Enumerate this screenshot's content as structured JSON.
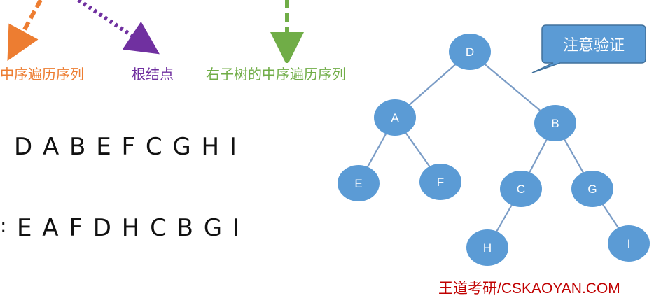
{
  "labels": {
    "left_inorder": "中序遍历序列",
    "root": "根结点",
    "right_inorder": "右子树的中序遍历序列"
  },
  "sequences": {
    "preorder": "D A B E F C G H I",
    "inorder_prefix": ":",
    "inorder": "E A F D H C B G I"
  },
  "callout": {
    "text": "注意验证"
  },
  "tree": {
    "nodes": [
      {
        "id": "D",
        "label": "D"
      },
      {
        "id": "A",
        "label": "A"
      },
      {
        "id": "B",
        "label": "B"
      },
      {
        "id": "E",
        "label": "E"
      },
      {
        "id": "F",
        "label": "F"
      },
      {
        "id": "C",
        "label": "C"
      },
      {
        "id": "G",
        "label": "G"
      },
      {
        "id": "H",
        "label": "H"
      },
      {
        "id": "I",
        "label": "I"
      }
    ],
    "edges": [
      [
        "D",
        "A"
      ],
      [
        "D",
        "B"
      ],
      [
        "A",
        "E"
      ],
      [
        "A",
        "F"
      ],
      [
        "B",
        "C"
      ],
      [
        "B",
        "G"
      ],
      [
        "C",
        "H"
      ],
      [
        "G",
        "I"
      ]
    ],
    "node_color": "#5b9bd5",
    "edge_color": "#7a9cc6"
  },
  "colors": {
    "orange": "#ed7d31",
    "purple": "#7030a0",
    "green": "#70ad47",
    "footer": "#c00000"
  },
  "footer": {
    "text": "王道考研/CSKAOYAN.COM"
  }
}
